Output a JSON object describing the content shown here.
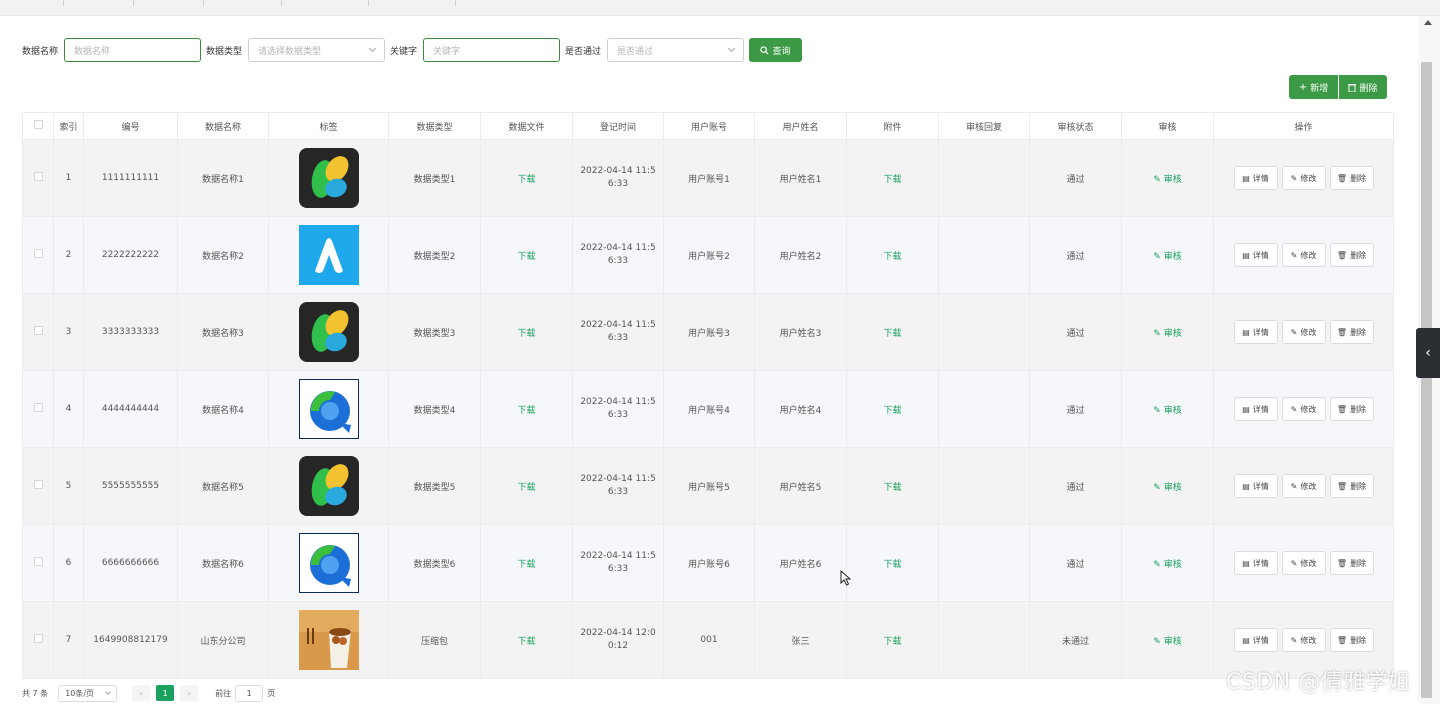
{
  "filters": {
    "name_label": "数据名称",
    "name_placeholder": "数据名称",
    "type_label": "数据类型",
    "type_placeholder": "请选择数据类型",
    "keyword_label": "关键字",
    "keyword_placeholder": "关键字",
    "pass_label": "是否通过",
    "pass_placeholder": "是否通过",
    "query_label": "查询"
  },
  "toolbar": {
    "add_label": "新增",
    "delete_label": "删除"
  },
  "table": {
    "headers": [
      "",
      "索引",
      "编号",
      "数据名称",
      "标签",
      "数据类型",
      "数据文件",
      "登记时间",
      "用户账号",
      "用户姓名",
      "附件",
      "审核回复",
      "审核状态",
      "审核",
      "操作"
    ],
    "rows": [
      {
        "index": "1",
        "code": "1111111111",
        "name": "数据名称1",
        "image": "green-yellow-blue-app",
        "type": "数据类型1",
        "file": "下载",
        "time": "2022-04-14 11:56:33",
        "account": "用户账号1",
        "username": "用户姓名1",
        "attach": "下载",
        "reply": "",
        "status": "通过",
        "audit": "审核"
      },
      {
        "index": "2",
        "code": "2222222222",
        "name": "数据名称2",
        "image": "blue-a-app",
        "type": "数据类型2",
        "file": "下载",
        "time": "2022-04-14 11:56:33",
        "account": "用户账号2",
        "username": "用户姓名2",
        "attach": "下载",
        "reply": "",
        "status": "通过",
        "audit": "审核"
      },
      {
        "index": "3",
        "code": "3333333333",
        "name": "数据名称3",
        "image": "green-yellow-blue-app",
        "type": "数据类型3",
        "file": "下载",
        "time": "2022-04-14 11:56:33",
        "account": "用户账号3",
        "username": "用户姓名3",
        "attach": "下载",
        "reply": "",
        "status": "通过",
        "audit": "审核"
      },
      {
        "index": "4",
        "code": "4444444444",
        "name": "数据名称4",
        "image": "green-blue-q-app",
        "type": "数据类型4",
        "file": "下载",
        "time": "2022-04-14 11:56:33",
        "account": "用户账号4",
        "username": "用户姓名4",
        "attach": "下载",
        "reply": "",
        "status": "通过",
        "audit": "审核"
      },
      {
        "index": "5",
        "code": "5555555555",
        "name": "数据名称5",
        "image": "green-yellow-blue-app",
        "type": "数据类型5",
        "file": "下载",
        "time": "2022-04-14 11:56:33",
        "account": "用户账号5",
        "username": "用户姓名5",
        "attach": "下载",
        "reply": "",
        "status": "通过",
        "audit": "审核"
      },
      {
        "index": "6",
        "code": "6666666666",
        "name": "数据名称6",
        "image": "green-blue-q-app",
        "type": "数据类型6",
        "file": "下载",
        "time": "2022-04-14 11:56:33",
        "account": "用户账号6",
        "username": "用户姓名6",
        "attach": "下载",
        "reply": "",
        "status": "通过",
        "audit": "审核"
      },
      {
        "index": "7",
        "code": "1649908812179",
        "name": "山东分公司",
        "image": "food-photo",
        "type": "压缩包",
        "file": "下载",
        "time": "2022-04-14 12:00:12",
        "account": "001",
        "username": "张三",
        "attach": "下载",
        "reply": "",
        "status": "未通过",
        "audit": "审核"
      }
    ],
    "ops": {
      "detail": "详情",
      "edit": "修改",
      "delete": "删除"
    }
  },
  "pager": {
    "total": "共 7 条",
    "page_size": "10条/页",
    "current": "1",
    "goto_prefix": "前往",
    "goto_value": "1",
    "goto_suffix": "页"
  },
  "watermark": "CSDN @倩雅学姐",
  "colors": {
    "accent": "#3c9a46",
    "link": "#1aa15f"
  }
}
